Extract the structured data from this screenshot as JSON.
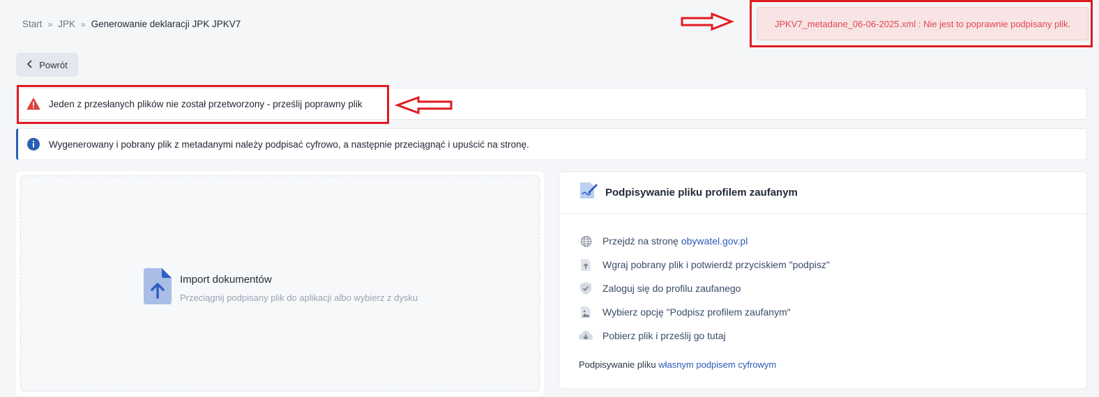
{
  "breadcrumb": {
    "items": [
      "Start",
      "JPK",
      "Generowanie deklaracji JPK JPKV7"
    ],
    "separator": "»"
  },
  "toast": {
    "message": "JPKV7_metadane_06-06-2025.xml : Nie jest to poprawnie podpisany plik."
  },
  "back_button": {
    "label": "Powrót"
  },
  "alerts": {
    "error": "Jeden z przesłanych plików nie został przetworzony - prześlij poprawny plik",
    "info": "Wygenerowany i pobrany plik z metadanymi należy podpisać cyfrowo, a następnie przeciągnąć i upuścić na stronę."
  },
  "import": {
    "title": "Import dokumentów",
    "subtitle": "Przeciągnij podpisany plik do aplikacji albo wybierz z dysku"
  },
  "sign": {
    "title": "Podpisywanie pliku profilem zaufanym",
    "steps": [
      {
        "text": "Przejdź na stronę ",
        "link": "obywatel.gov.pl",
        "icon": "globe-icon"
      },
      {
        "text": "Wgraj pobrany plik i potwierdź przyciskiem \"podpisz\"",
        "icon": "file-upload-icon"
      },
      {
        "text": "Zaloguj się do profilu zaufanego",
        "icon": "shield-check-icon"
      },
      {
        "text": "Wybierz opcję \"Podpisz profilem zaufanym\"",
        "icon": "file-image-icon"
      },
      {
        "text": "Pobierz plik i prześlij go tutaj",
        "icon": "cloud-download-icon"
      }
    ],
    "footer_text": "Podpisywanie pliku ",
    "footer_link": "własnym podpisem cyfrowym"
  },
  "colors": {
    "annotation_red": "#e11b22",
    "toast_text": "#e0464f",
    "link": "#2b59b5",
    "info_accent": "#2a5fb4"
  }
}
